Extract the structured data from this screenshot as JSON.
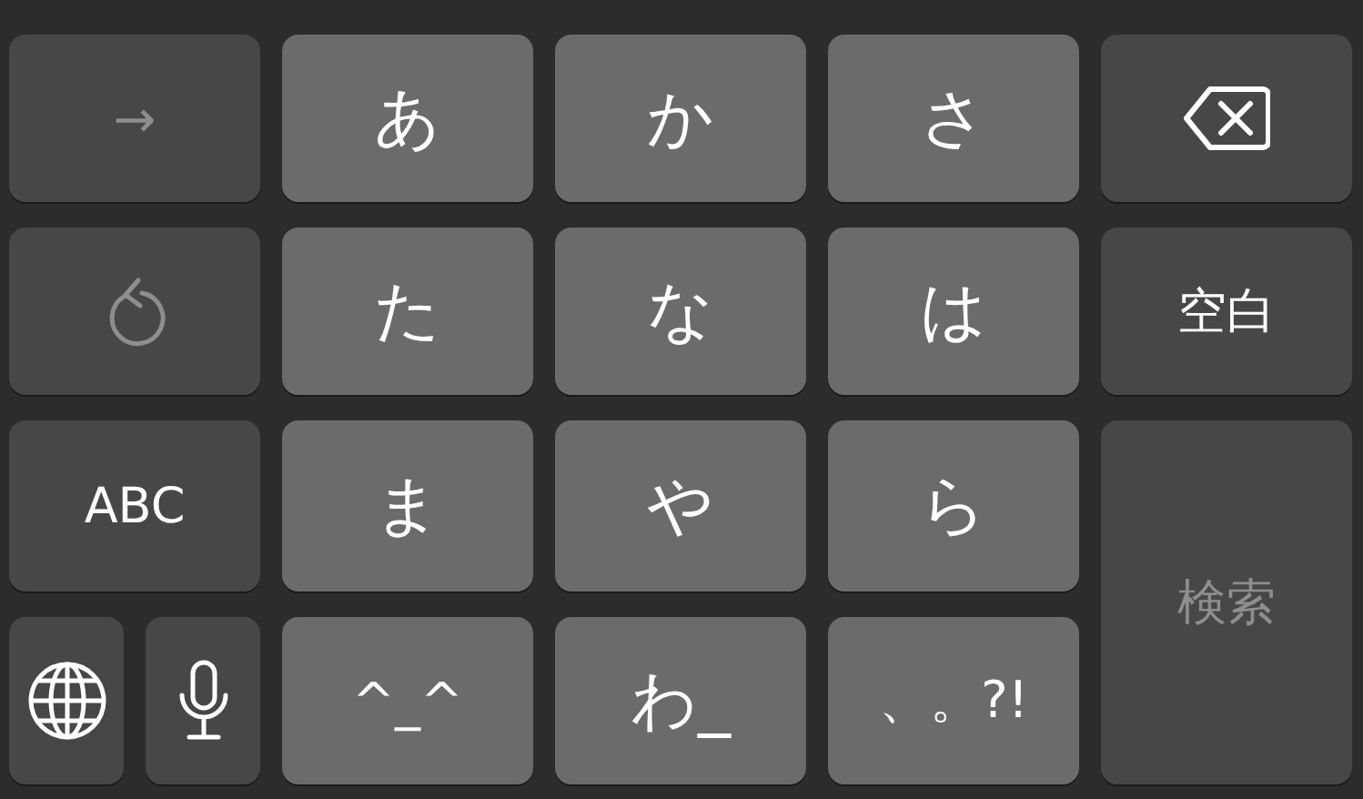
{
  "keyboard": {
    "keys": [
      {
        "kind": "function",
        "label": "→",
        "disabled": true
      },
      {
        "kind": "letter",
        "label": "あ"
      },
      {
        "kind": "letter",
        "label": "か"
      },
      {
        "kind": "letter",
        "label": "さ"
      },
      {
        "kind": "delete",
        "disabled": false
      },
      {
        "kind": "undo",
        "disabled": true
      },
      {
        "kind": "letter",
        "label": "た"
      },
      {
        "kind": "letter",
        "label": "な"
      },
      {
        "kind": "letter",
        "label": "は"
      },
      {
        "kind": "function",
        "label": "空白",
        "disabled": false
      },
      {
        "kind": "function",
        "label": "ABC",
        "disabled": false
      },
      {
        "kind": "letter",
        "label": "ま"
      },
      {
        "kind": "letter",
        "label": "や"
      },
      {
        "kind": "letter",
        "label": "ら"
      },
      {
        "kind": "function",
        "label": "検索",
        "disabled": true,
        "tall": true
      },
      {
        "kind": "pair",
        "keys": [
          {
            "kind": "globe"
          },
          {
            "kind": "mic"
          }
        ]
      },
      {
        "kind": "letter",
        "label": "^_^"
      },
      {
        "kind": "letter",
        "label": "わ_"
      },
      {
        "kind": "letter",
        "label": "、。?!"
      }
    ]
  }
}
